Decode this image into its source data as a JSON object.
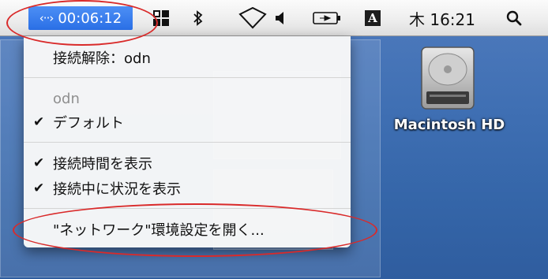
{
  "menubar": {
    "ppp_timer": "00:06:12",
    "ppp_arrow": "‹··›",
    "input_badge": "A",
    "clock": "木 16:21",
    "icons": [
      "ppp-connection-icon",
      "spaces-grid-icon",
      "bluetooth-icon",
      "airport-wifi-icon",
      "volume-icon",
      "battery-icon",
      "input-menu-icon",
      "spotlight-search-icon"
    ]
  },
  "menu": {
    "disconnect": "接続解除：odn",
    "service_header": "odn",
    "default_config": "デフォルト",
    "show_time": "接続時間を表示",
    "show_status": "接続中に状況を表示",
    "open_prefs": "\"ネットワーク\"環境設定を開く..."
  },
  "desktop": {
    "hd_label": "Macintosh HD"
  },
  "colors": {
    "highlight": "#2a6fe6",
    "annotation": "#d92a2a",
    "desktop": "#3f6fb3"
  }
}
